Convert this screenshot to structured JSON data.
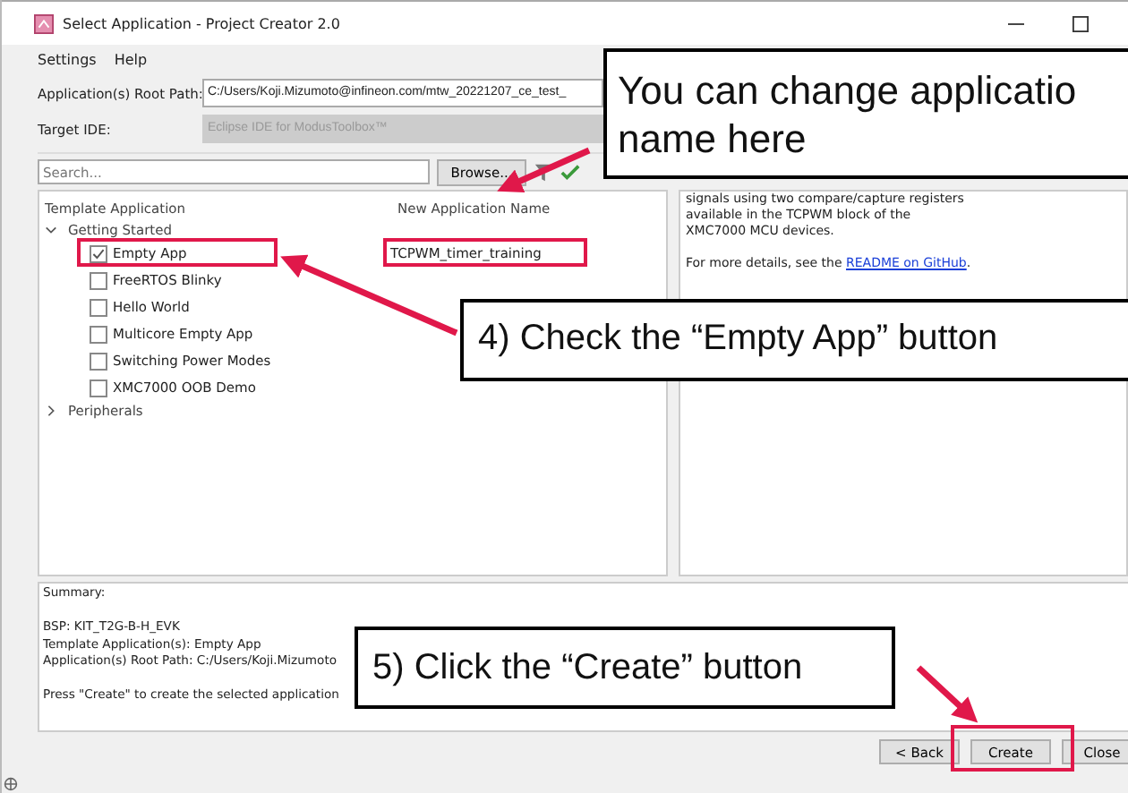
{
  "window": {
    "title": "Select Application - Project Creator 2.0"
  },
  "menu": [
    "Settings",
    "Help"
  ],
  "fields": [
    {
      "label": "Application(s) Root Path:",
      "value": "C:/Users/Koji.Mizumoto@infineon.com/mtw_20221207_ce_test_",
      "disabled": false
    },
    {
      "label": "Target IDE:",
      "value": "Eclipse IDE for ModusToolbox™",
      "disabled": true
    }
  ],
  "search": {
    "placeholder": "Search..."
  },
  "browse_button": "Browse...",
  "columns": [
    "Template Application",
    "New Application Name"
  ],
  "tree": [
    {
      "label": "Getting Started",
      "expanded": true,
      "children": [
        {
          "label": "Empty App",
          "checked": true
        },
        {
          "label": "FreeRTOS Blinky",
          "checked": false
        },
        {
          "label": "Hello World",
          "checked": false
        },
        {
          "label": "Multicore Empty App",
          "checked": false
        },
        {
          "label": "Switching Power Modes",
          "checked": false
        },
        {
          "label": "XMC7000 OOB Demo",
          "checked": false
        }
      ]
    },
    {
      "label": "Peripherals",
      "expanded": false
    }
  ],
  "new_name": "TCPWM_timer_training",
  "description": {
    "text": "signals using two compare/capture registers available in the TCPWM block of the XMC7000 MCU devices.",
    "more": "For more details, see the",
    "link": "README on GitHub",
    "end": "."
  },
  "summary": [
    [
      "Summary:"
    ],
    [
      "BSP: KIT_T2G-B-H_EVK",
      "Template Application(s): Empty App",
      "Application(s) Root Path: C:/Users/Koji.Mizumoto"
    ],
    [
      "Press \"Create\" to create the selected application"
    ]
  ],
  "buttons": [
    "< Back",
    "Create",
    "Close"
  ],
  "callouts": [
    {
      "lines": [
        "You can change applicatio",
        "name here"
      ]
    },
    {
      "lines": [
        "4) Check the “Empty App” button"
      ]
    },
    {
      "lines": [
        "5) Click the “Create” button"
      ]
    }
  ]
}
